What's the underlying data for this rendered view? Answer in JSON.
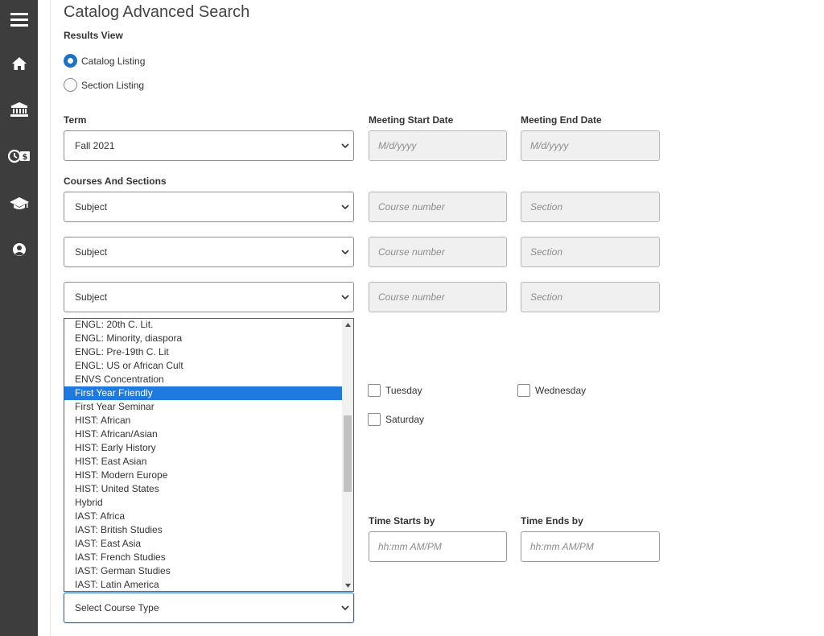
{
  "sidebar": {
    "items": [
      {
        "icon": "menu-icon"
      },
      {
        "icon": "home-icon"
      },
      {
        "icon": "bank-icon"
      },
      {
        "icon": "finance-icon"
      },
      {
        "icon": "graduation-cap-icon"
      },
      {
        "icon": "user-icon"
      }
    ]
  },
  "page": {
    "title": "Catalog Advanced Search"
  },
  "results_view": {
    "label": "Results View",
    "options": [
      {
        "label": "Catalog Listing",
        "checked": true
      },
      {
        "label": "Section Listing",
        "checked": false
      }
    ]
  },
  "term": {
    "label": "Term",
    "value": "Fall 2021"
  },
  "meeting_start": {
    "label": "Meeting Start Date",
    "placeholder": "M/d/yyyy"
  },
  "meeting_end": {
    "label": "Meeting End Date",
    "placeholder": "M/d/yyyy"
  },
  "courses": {
    "label": "Courses And Sections",
    "rows": [
      {
        "subject": "Subject",
        "course_placeholder": "Course number",
        "section_placeholder": "Section"
      },
      {
        "subject": "Subject",
        "course_placeholder": "Course number",
        "section_placeholder": "Section"
      },
      {
        "subject": "Subject",
        "course_placeholder": "Course number",
        "section_placeholder": "Section"
      }
    ]
  },
  "dropdown": {
    "options": [
      "ENGL: 20th C. Lit.",
      "ENGL: Minority, diaspora",
      "ENGL: Pre-19th C. Lit",
      "ENGL: US or African Cult",
      "ENVS Concentration",
      "First Year Friendly",
      "First Year Seminar",
      "HIST: African",
      "HIST: African/Asian",
      "HIST: Early History",
      "HIST: East Asian",
      "HIST: Modern Europe",
      "HIST: United States",
      "Hybrid",
      "IAST: Africa",
      "IAST: British Studies",
      "IAST: East Asia",
      "IAST: French Studies",
      "IAST: German Studies",
      "IAST: Latin America"
    ],
    "selected": "First Year Friendly"
  },
  "days": {
    "tuesday": "Tuesday",
    "wednesday": "Wednesday",
    "saturday": "Saturday"
  },
  "time_starts": {
    "label": "Time Starts by",
    "placeholder": "hh:mm AM/PM"
  },
  "time_ends": {
    "label": "Time Ends by",
    "placeholder": "hh:mm AM/PM"
  },
  "course_type": {
    "value": "Select Course Type"
  },
  "colors": {
    "sidebar": "#3d3d3d",
    "accent": "#1a73c6",
    "selected_option": "#1f7ae0"
  }
}
